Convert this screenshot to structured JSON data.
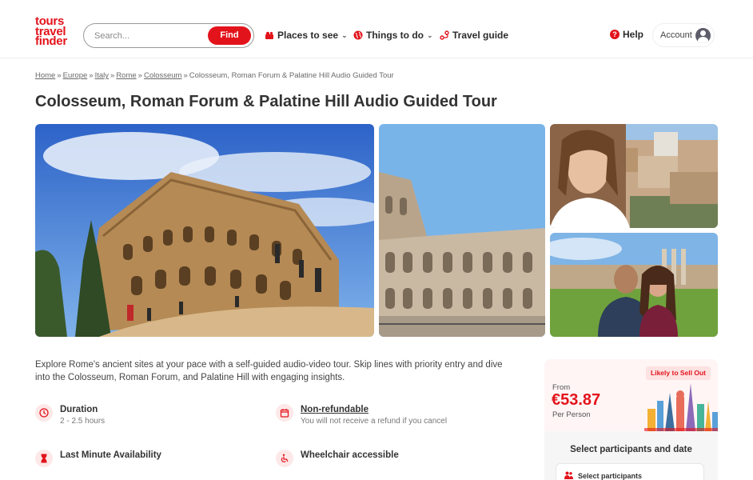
{
  "brand": {
    "logo_lines": [
      "tours",
      "travel",
      "finder"
    ],
    "accent_color": "#e3131b"
  },
  "search": {
    "placeholder": "Search...",
    "button_label": "Find"
  },
  "nav": [
    {
      "label": "Places to see",
      "icon": "map-pin-icon",
      "has_dropdown": true
    },
    {
      "label": "Things to do",
      "icon": "globe-icon",
      "has_dropdown": true
    },
    {
      "label": "Travel guide",
      "icon": "route-icon",
      "has_dropdown": false
    }
  ],
  "header_right": {
    "help_label": "Help",
    "account_label": "Account"
  },
  "breadcrumb": {
    "links": [
      "Home",
      "Europe",
      "Italy",
      "Rome",
      "Colosseum"
    ],
    "separator": "»",
    "current": "Colosseum, Roman Forum & Palatine Hill Audio Guided Tour"
  },
  "page": {
    "title": "Colosseum, Roman Forum & Palatine Hill Audio Guided Tour"
  },
  "gallery": [
    {
      "icon": "colosseum-wide-photo"
    },
    {
      "icon": "colosseum-close-photo"
    },
    {
      "icon": "woman-selfie-forum-photo"
    },
    {
      "icon": "couple-selfie-forum-photo"
    }
  ],
  "description": "Explore Rome's ancient sites at your pace with a self-guided audio-video tour. Skip lines with priority entry and dive into the Colosseum, Roman Forum, and Palatine Hill with engaging insights.",
  "features": {
    "duration": {
      "title": "Duration",
      "subtitle": "2 - 2.5 hours",
      "icon": "clock-icon"
    },
    "refund": {
      "title": "Non-refundable",
      "subtitle": "You will not receive a refund if you cancel",
      "icon": "calendar-icon"
    },
    "last_minute": {
      "title": "Last Minute Availability",
      "icon": "hourglass-icon"
    },
    "wheelchair": {
      "title": "Wheelchair accessible",
      "icon": "wheelchair-icon"
    }
  },
  "booking": {
    "badge": "Likely to Sell Out",
    "from_label": "From",
    "price": "€53.87",
    "per_label": "Per Person",
    "select_heading": "Select participants and date",
    "participants_label": "Select participants"
  }
}
